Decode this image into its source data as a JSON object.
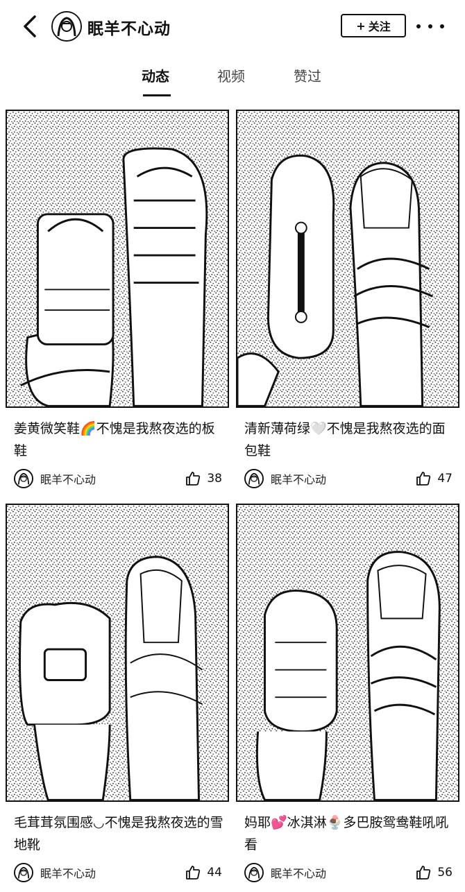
{
  "header": {
    "username": "眠羊不心动",
    "follow_label": "关注"
  },
  "tabs": [
    {
      "label": "动态",
      "active": true
    },
    {
      "label": "视频",
      "active": false
    },
    {
      "label": "赞过",
      "active": false
    }
  ],
  "posts": [
    {
      "caption": "姜黄微笑鞋🌈不愧是我熬夜选的板鞋",
      "author": "眠羊不心动",
      "likes": "38"
    },
    {
      "caption": "清新薄荷绿🤍不愧是我熬夜选的面包鞋",
      "author": "眠羊不心动",
      "likes": "47"
    },
    {
      "caption": "毛茸茸氛围感◡不愧是我熬夜选的雪地靴",
      "author": "眠羊不心动",
      "likes": "44"
    },
    {
      "caption": "妈耶💕冰淇淋🍨多巴胺鸳鸯鞋吼吼看",
      "author": "眠羊不心动",
      "likes": "56"
    }
  ],
  "colors": {
    "ink": "#111111",
    "background": "#ffffff"
  }
}
